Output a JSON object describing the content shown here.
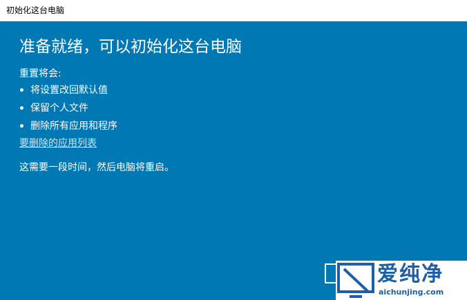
{
  "window": {
    "title": "初始化这台电脑"
  },
  "main": {
    "heading": "准备就绪，可以初始化这台电脑",
    "intro": "重置将会:",
    "bullets": [
      "将设置改回默认值",
      "保留个人文件",
      "删除所有应用和程序"
    ],
    "app_list_link": "要删除的应用列表",
    "note": "这需要一段时间，然后电脑将重启。"
  },
  "watermark": {
    "brand": "爱纯净",
    "url": "aichunjing.com",
    "logo_icon": "monitor-slash-icon"
  },
  "colors": {
    "background": "#0078b4",
    "text": "#ffffff",
    "link": "#cfe6f5",
    "watermark": "#1a5fa8"
  }
}
